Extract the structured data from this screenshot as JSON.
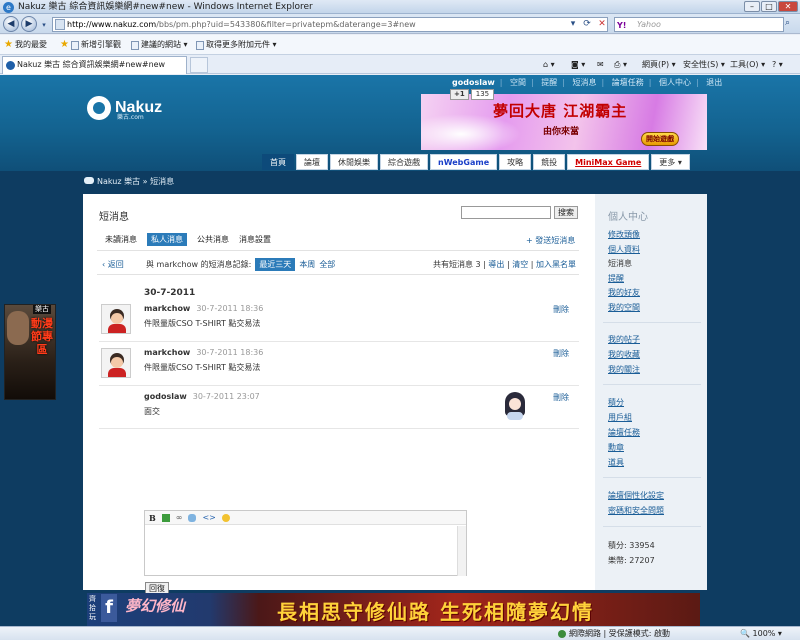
{
  "window": {
    "title": "Nakuz 樂古 綜合資訊娛樂網#new#new - Windows Internet Explorer"
  },
  "address": {
    "url_domain": "http://www.nakuz.com",
    "url_path": "/bbs/pm.php?uid=543380&filter=privatepm&daterange=3#new",
    "search_placeholder": "Yahoo",
    "search_brand": "Y!"
  },
  "favorites": {
    "favorites_label": "我的最愛",
    "items": [
      "新增引擎觀",
      "建議的網站 ▾",
      "取得更多附加元件 ▾"
    ]
  },
  "tab": {
    "label": "Nakuz 樂古 綜合資訊娛樂網#new#new"
  },
  "commandbar": {
    "page": "網頁(P) ▾",
    "safety": "安全性(S) ▾",
    "tools": "工具(O) ▾"
  },
  "site": {
    "toplinks": [
      "godoslaw",
      "空間",
      "提醒",
      "短消息",
      "論壇任務",
      "個人中心",
      "退出"
    ],
    "logo_text": "Nakuz",
    "logo_sub": "樂古.com",
    "plusone": "+1",
    "plusone_count": "135",
    "banner_title": "夢回大唐  江湖霸主",
    "banner_sub": "由你來當",
    "banner_btn": "開始遊戲",
    "nav": [
      "首頁",
      "論壇",
      "休閒娛樂",
      "綜合遊戲",
      "nWebGame",
      "攻略",
      "競投",
      "MiniMax Game",
      "更多 ▾"
    ],
    "breadcrumb": "Nakuz 樂古 » 短消息"
  },
  "pm": {
    "title": "短消息",
    "search_btn": "搜索",
    "filters": [
      "未讀消息",
      "私人消息",
      "公共消息",
      "消息設置"
    ],
    "send": "+ 發送短消息",
    "back": "‹ 返回",
    "with_prefix": "與 markchow 的短消息記錄:",
    "ranges": [
      "最近三天",
      "本周",
      "全部"
    ],
    "total": "共有短消息 3",
    "export": "導出",
    "clear": "清空",
    "blacklist": "加入黑名單",
    "date": "30-7-2011",
    "messages": [
      {
        "name": "markchow",
        "time": "30-7-2011 18:36",
        "body": "件限量版CSO T-SHIRT  點交易法",
        "action": "刪除"
      },
      {
        "name": "markchow",
        "time": "30-7-2011 18:36",
        "body": "件限量版CSO T-SHIRT  點交易法",
        "action": "刪除"
      },
      {
        "name": "godoslaw",
        "time": "30-7-2011 23:07",
        "body": "面交",
        "action": "刪除"
      }
    ],
    "reply": "回復"
  },
  "sidebar": {
    "title": "個人中心",
    "group1": [
      "修改頭像",
      "個人資料",
      "短消息",
      "提醒",
      "我的好友",
      "我的空間"
    ],
    "group2": [
      "我的帖子",
      "我的收藏",
      "我的關注"
    ],
    "group3": [
      "積分",
      "用戶組",
      "論壇任務",
      "勳章",
      "道具"
    ],
    "group4": [
      "論壇個性化設定",
      "密碼和安全問題"
    ],
    "points": "積分: 33954",
    "credit": "樂幣: 27207"
  },
  "ads": {
    "left_tag": "樂古",
    "left_text": "動漫節專區",
    "bottom_side": "齊拾玩",
    "bottom_game": "夢幻修仙",
    "bottom_slogan": "長相思守修仙路 生死相隨夢幻情"
  },
  "status": {
    "zone": "網際網路 | 受保護模式: 啟動",
    "zoom": "100%"
  }
}
